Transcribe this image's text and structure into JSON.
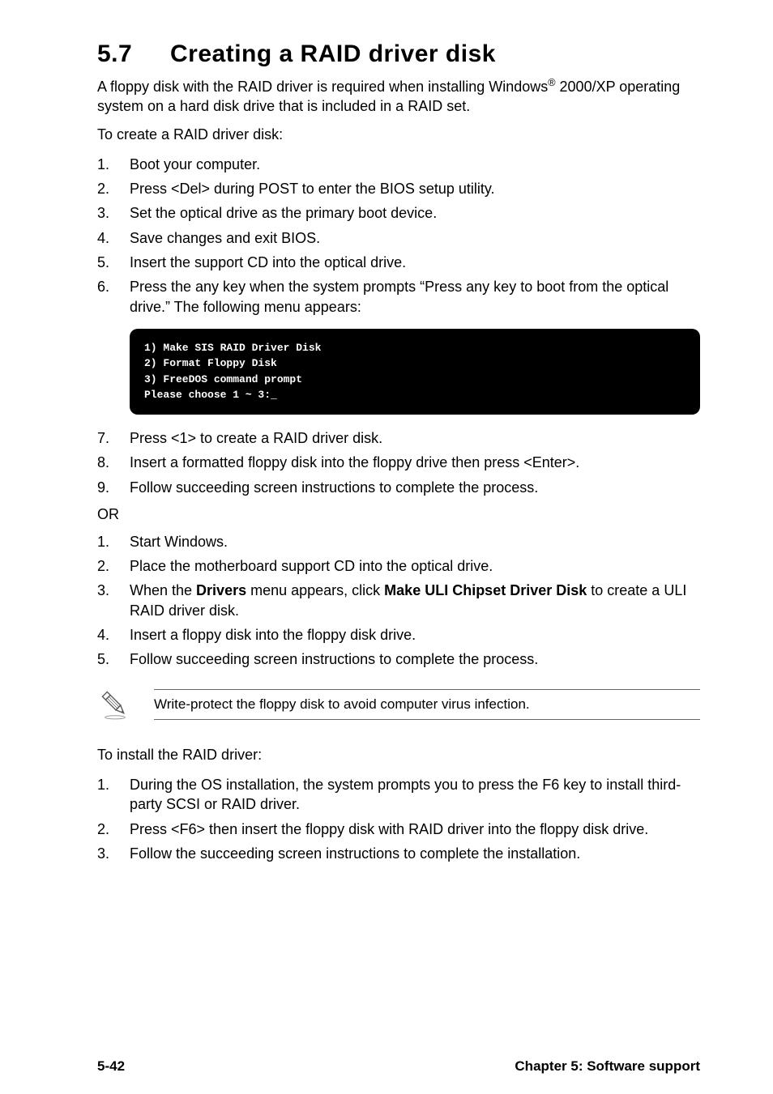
{
  "section_number": "5.7",
  "section_title": "Creating a RAID driver disk",
  "intro_paragraph_1": "A floppy disk with the RAID driver is required when installing Windows",
  "intro_paragraph_1_sup": "®",
  "intro_paragraph_1b": " 2000/XP operating system on a hard disk drive that is included in a RAID set.",
  "intro_paragraph_2": "To create a RAID driver disk:",
  "steps_a": [
    "Boot your computer.",
    "Press <Del> during POST to enter the BIOS setup utility.",
    "Set the optical drive as the primary boot device.",
    "Save changes and exit BIOS.",
    "Insert the support CD into the optical drive.",
    "Press the any key when the system prompts “Press any key to boot from the optical drive.” The following menu appears:"
  ],
  "terminal_lines": [
    "1) Make SIS RAID Driver Disk",
    "2) Format Floppy Disk",
    "3) FreeDOS command prompt",
    "Please choose 1 ~ 3:_"
  ],
  "steps_b": [
    {
      "n": "7.",
      "t": "Press <1> to create a RAID driver disk."
    },
    {
      "n": "8.",
      "t": "Insert a formatted floppy disk into the floppy drive then press <Enter>."
    },
    {
      "n": "9.",
      "t": "Follow succeeding screen instructions to complete the process."
    }
  ],
  "or_label": "OR",
  "steps_c": [
    {
      "n": "1.",
      "t": "Start Windows."
    },
    {
      "n": "2.",
      "t": "Place the motherboard support CD into the optical drive."
    },
    {
      "n": "3.",
      "prefix": "When the ",
      "bold1": "Drivers",
      "mid": " menu appears, click ",
      "bold2": "Make ULI Chipset Driver Disk",
      "suffix": " to create a ULI RAID driver disk."
    },
    {
      "n": "4.",
      "t": "Insert a floppy disk into the floppy disk drive."
    },
    {
      "n": "5.",
      "t": "Follow succeeding screen instructions to complete the process."
    }
  ],
  "note_text": "Write-protect the floppy disk to avoid computer virus infection.",
  "install_heading": "To install the RAID driver:",
  "steps_d": [
    {
      "n": "1.",
      "t": "During the OS installation, the system prompts you to press the F6 key to install third-party SCSI or RAID driver."
    },
    {
      "n": "2.",
      "t": "Press <F6> then insert the floppy disk with RAID driver into the floppy disk drive."
    },
    {
      "n": "3.",
      "t": "Follow the succeeding screen instructions to complete the installation."
    }
  ],
  "footer_left": "5-42",
  "footer_right": "Chapter 5: Software support"
}
